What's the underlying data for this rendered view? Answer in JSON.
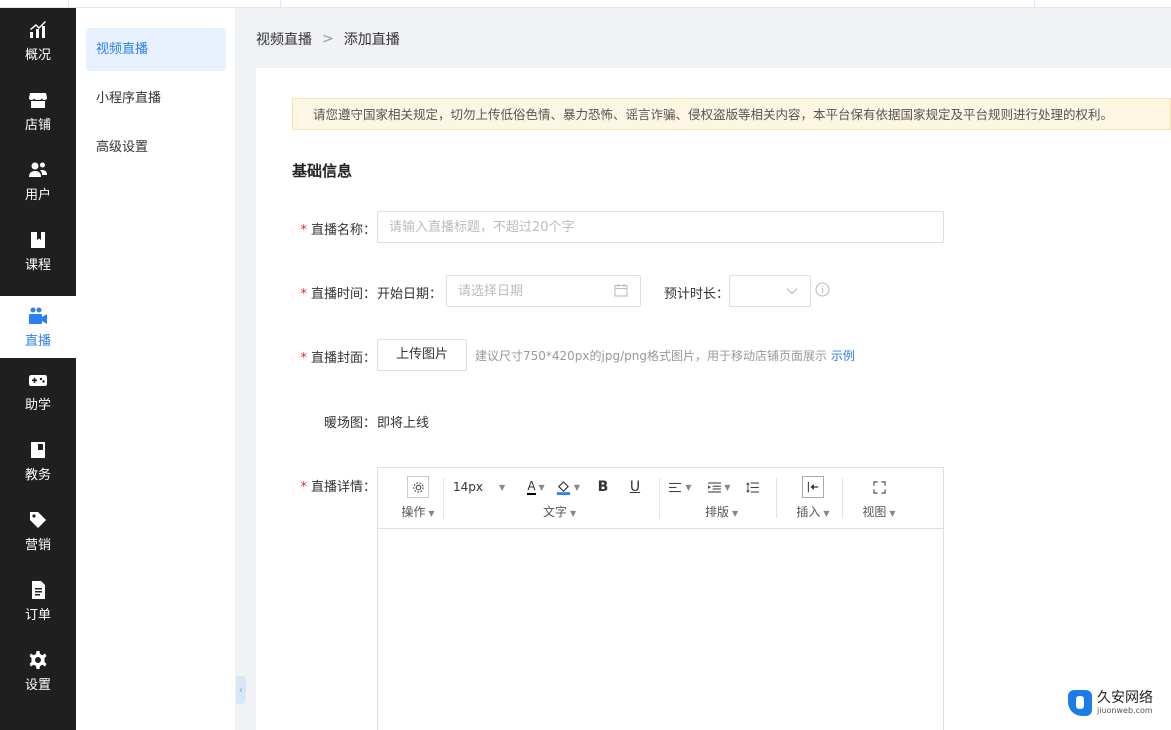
{
  "nav": {
    "items": [
      {
        "label": "概况",
        "icon": "chart-up-icon"
      },
      {
        "label": "店铺",
        "icon": "store-icon"
      },
      {
        "label": "用户",
        "icon": "users-icon"
      },
      {
        "label": "课程",
        "icon": "book-icon"
      },
      {
        "label": "直播",
        "icon": "video-camera-icon"
      },
      {
        "label": "助学",
        "icon": "gamepad-icon"
      },
      {
        "label": "教务",
        "icon": "calendar-book-icon"
      },
      {
        "label": "营销",
        "icon": "tag-icon"
      },
      {
        "label": "订单",
        "icon": "document-icon"
      },
      {
        "label": "设置",
        "icon": "gear-icon"
      }
    ],
    "active_index": 4
  },
  "submenu": {
    "items": [
      {
        "label": "视频直播"
      },
      {
        "label": "小程序直播"
      },
      {
        "label": "高级设置"
      }
    ],
    "active_index": 0
  },
  "breadcrumb": {
    "first": "视频直播",
    "separator": ">",
    "current": "添加直播"
  },
  "notice": "请您遵守国家相关规定，切勿上传低俗色情、暴力恐怖、谣言诈骗、侵权盗版等相关内容，本平台保有依据国家规定及平台规则进行处理的权利。",
  "section_title": "基础信息",
  "form": {
    "required_mark": "*",
    "name": {
      "label": "直播名称：",
      "placeholder": "请输入直播标题，不超过20个字",
      "value": ""
    },
    "time": {
      "label": "直播时间：",
      "start_label": "开始日期：",
      "start_placeholder": "请选择日期",
      "duration_label": "预计时长：",
      "duration_value": ""
    },
    "cover": {
      "label": "直播封面：",
      "upload_button": "上传图片",
      "hint": "建议尺寸750*420px的jpg/png格式图片，用于移动店铺页面展示",
      "example_link": "示例"
    },
    "warmup": {
      "label": "暖场图：",
      "value": "即将上线"
    },
    "detail": {
      "label": "直播详情："
    }
  },
  "editor": {
    "font_size": "14px",
    "groups": {
      "operate": "操作",
      "text": "文字",
      "layout": "排版",
      "insert": "插入",
      "view": "视图"
    },
    "bold": "B",
    "underline": "U",
    "font_color_glyph": "A"
  },
  "colors": {
    "primary": "#2d7ff9",
    "nav_bg": "#1f1f1f",
    "required": "#f5222d",
    "notice_bg": "#fdf6e3"
  },
  "watermark": {
    "title": "久安网络",
    "subtitle": "jiuonweb.com"
  }
}
